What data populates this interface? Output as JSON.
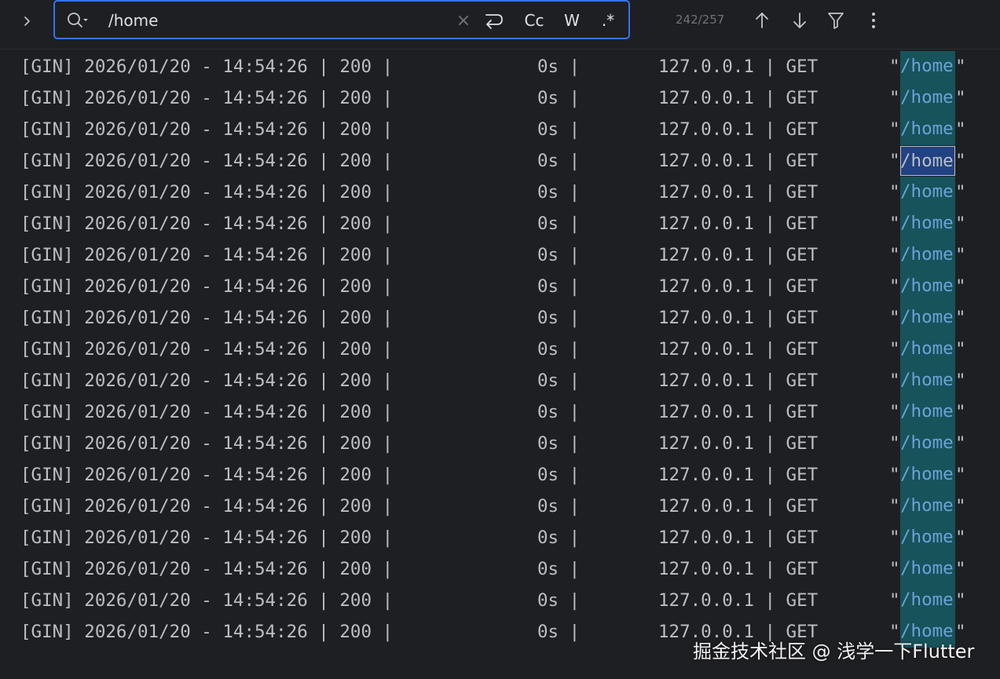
{
  "search": {
    "query": "/home",
    "clear_glyph": "×",
    "case_label": "Cc",
    "word_label": "W",
    "regex_label": ".*",
    "match_count": "242/257"
  },
  "log": {
    "match_text": "/home",
    "current_match_row": 3,
    "lines": [
      {
        "prefix": "[GIN] 2026/01/20 - 14:54:26 | 200 |",
        "duration": "0s |",
        "ip": "127.0.0.1 | GET",
        "quote_open": "\"",
        "path": "/home",
        "quote_close": "\""
      },
      {
        "prefix": "[GIN] 2026/01/20 - 14:54:26 | 200 |",
        "duration": "0s |",
        "ip": "127.0.0.1 | GET",
        "quote_open": "\"",
        "path": "/home",
        "quote_close": "\""
      },
      {
        "prefix": "[GIN] 2026/01/20 - 14:54:26 | 200 |",
        "duration": "0s |",
        "ip": "127.0.0.1 | GET",
        "quote_open": "\"",
        "path": "/home",
        "quote_close": "\""
      },
      {
        "prefix": "[GIN] 2026/01/20 - 14:54:26 | 200 |",
        "duration": "0s |",
        "ip": "127.0.0.1 | GET",
        "quote_open": "\"",
        "path": "/home",
        "quote_close": "\""
      },
      {
        "prefix": "[GIN] 2026/01/20 - 14:54:26 | 200 |",
        "duration": "0s |",
        "ip": "127.0.0.1 | GET",
        "quote_open": "\"",
        "path": "/home",
        "quote_close": "\""
      },
      {
        "prefix": "[GIN] 2026/01/20 - 14:54:26 | 200 |",
        "duration": "0s |",
        "ip": "127.0.0.1 | GET",
        "quote_open": "\"",
        "path": "/home",
        "quote_close": "\""
      },
      {
        "prefix": "[GIN] 2026/01/20 - 14:54:26 | 200 |",
        "duration": "0s |",
        "ip": "127.0.0.1 | GET",
        "quote_open": "\"",
        "path": "/home",
        "quote_close": "\""
      },
      {
        "prefix": "[GIN] 2026/01/20 - 14:54:26 | 200 |",
        "duration": "0s |",
        "ip": "127.0.0.1 | GET",
        "quote_open": "\"",
        "path": "/home",
        "quote_close": "\""
      },
      {
        "prefix": "[GIN] 2026/01/20 - 14:54:26 | 200 |",
        "duration": "0s |",
        "ip": "127.0.0.1 | GET",
        "quote_open": "\"",
        "path": "/home",
        "quote_close": "\""
      },
      {
        "prefix": "[GIN] 2026/01/20 - 14:54:26 | 200 |",
        "duration": "0s |",
        "ip": "127.0.0.1 | GET",
        "quote_open": "\"",
        "path": "/home",
        "quote_close": "\""
      },
      {
        "prefix": "[GIN] 2026/01/20 - 14:54:26 | 200 |",
        "duration": "0s |",
        "ip": "127.0.0.1 | GET",
        "quote_open": "\"",
        "path": "/home",
        "quote_close": "\""
      },
      {
        "prefix": "[GIN] 2026/01/20 - 14:54:26 | 200 |",
        "duration": "0s |",
        "ip": "127.0.0.1 | GET",
        "quote_open": "\"",
        "path": "/home",
        "quote_close": "\""
      },
      {
        "prefix": "[GIN] 2026/01/20 - 14:54:26 | 200 |",
        "duration": "0s |",
        "ip": "127.0.0.1 | GET",
        "quote_open": "\"",
        "path": "/home",
        "quote_close": "\""
      },
      {
        "prefix": "[GIN] 2026/01/20 - 14:54:26 | 200 |",
        "duration": "0s |",
        "ip": "127.0.0.1 | GET",
        "quote_open": "\"",
        "path": "/home",
        "quote_close": "\""
      },
      {
        "prefix": "[GIN] 2026/01/20 - 14:54:26 | 200 |",
        "duration": "0s |",
        "ip": "127.0.0.1 | GET",
        "quote_open": "\"",
        "path": "/home",
        "quote_close": "\""
      },
      {
        "prefix": "[GIN] 2026/01/20 - 14:54:26 | 200 |",
        "duration": "0s |",
        "ip": "127.0.0.1 | GET",
        "quote_open": "\"",
        "path": "/home",
        "quote_close": "\""
      },
      {
        "prefix": "[GIN] 2026/01/20 - 14:54:26 | 200 |",
        "duration": "0s |",
        "ip": "127.0.0.1 | GET",
        "quote_open": "\"",
        "path": "/home",
        "quote_close": "\""
      },
      {
        "prefix": "[GIN] 2026/01/20 - 14:54:26 | 200 |",
        "duration": "0s |",
        "ip": "127.0.0.1 | GET",
        "quote_open": "\"",
        "path": "/home",
        "quote_close": "\""
      },
      {
        "prefix": "[GIN] 2026/01/20 - 14:54:26 | 200 |",
        "duration": "0s |",
        "ip": "127.0.0.1 | GET",
        "quote_open": "\"",
        "path": "/home",
        "quote_close": "\""
      }
    ]
  },
  "watermark": {
    "text": "掘金技术社区 @ 浅学一下Flutter"
  },
  "colors": {
    "background": "#1e1f22",
    "text": "#bcbec4",
    "search_border": "#3574f0",
    "match_highlight": "#17535b",
    "match_text": "#6aa2d8",
    "current_match_highlight": "#214283"
  },
  "icons": {
    "expand": "chevron-right-icon",
    "search": "search-with-history-icon",
    "clear": "close-icon",
    "wrap": "soft-wrap-icon",
    "prev": "arrow-up-icon",
    "next": "arrow-down-icon",
    "filter": "filter-icon",
    "more": "more-vertical-icon"
  }
}
